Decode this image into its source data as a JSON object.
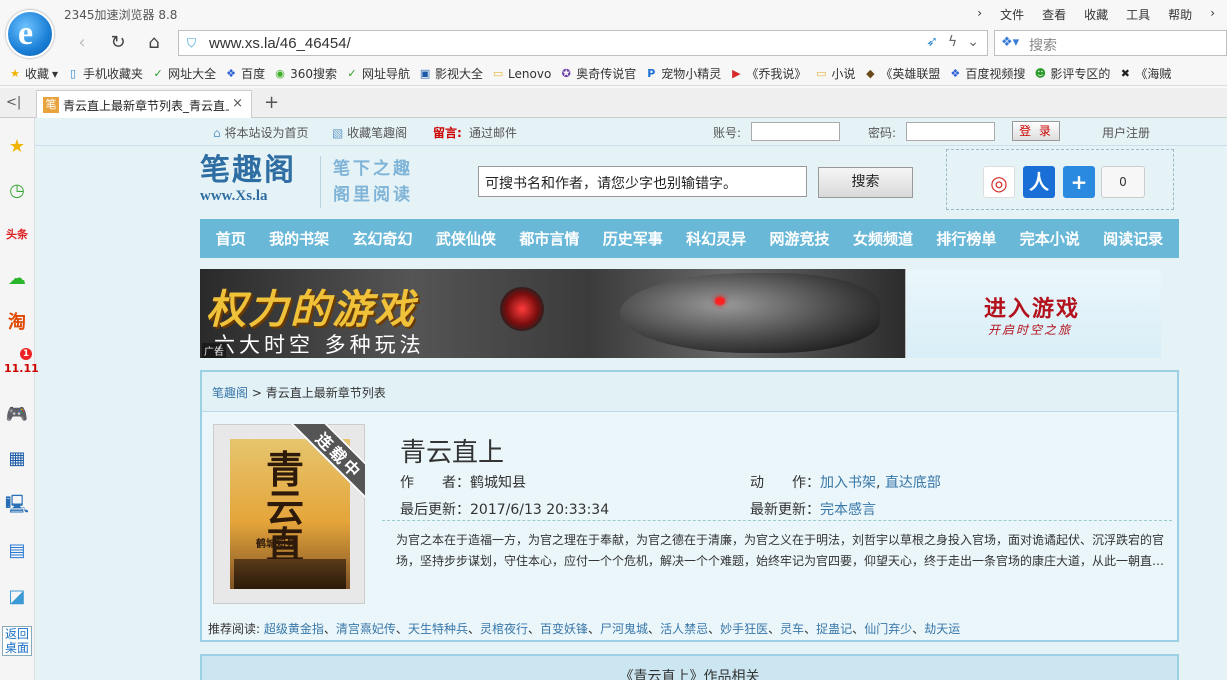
{
  "browser": {
    "app_title": "2345加速浏览器 8.8",
    "logo_letter": "e",
    "menu": [
      "文件",
      "查看",
      "收藏",
      "工具",
      "帮助"
    ],
    "url": "www.xs.la/46_46454/",
    "search_placeholder": "搜索",
    "bookmarks": [
      {
        "label": "收藏",
        "icon": "star-icon"
      },
      {
        "label": "手机收藏夹",
        "icon": "phone-icon"
      },
      {
        "label": "网址大全",
        "icon": "hao-icon"
      },
      {
        "label": "百度",
        "icon": "baidu-paw-icon"
      },
      {
        "label": "360搜索",
        "icon": "360-icon"
      },
      {
        "label": "网址导航",
        "icon": "hao-icon"
      },
      {
        "label": "影视大全",
        "icon": "video-icon"
      },
      {
        "label": "Lenovo",
        "icon": "folder-icon"
      },
      {
        "label": "奥奇传说官",
        "icon": "game-icon"
      },
      {
        "label": "宠物小精灵",
        "icon": "p-icon"
      },
      {
        "label": "《乔我说》",
        "icon": "play-icon"
      },
      {
        "label": "小说",
        "icon": "folder-icon"
      },
      {
        "label": "《英雄联盟",
        "icon": "lol-icon"
      },
      {
        "label": "百度视频搜",
        "icon": "baidu-paw-icon"
      },
      {
        "label": "影评专区的",
        "icon": "panda-icon"
      },
      {
        "label": "《海贼",
        "icon": "pirate-icon"
      }
    ],
    "tab": {
      "favicon": "笔",
      "title": "青云直上最新章节列表_青云直上",
      "close": "×"
    },
    "new_tab": "+",
    "sidebar_back": "返回桌面",
    "sidebar_badge": "1"
  },
  "site": {
    "topbar": {
      "set_home": "将本站设为首页",
      "bookmark": "收藏笔趣阁",
      "message_label": "留言:",
      "message_link": "通过邮件",
      "account_label": "账号:",
      "password_label": "密码:",
      "login": "登 录",
      "register": "用户注册"
    },
    "logo_cn": "笔趣阁",
    "logo_en": "www.Xs.la",
    "slogan_1": "笔下之趣",
    "slogan_2": "阁里阅读",
    "search_text": "可搜书名和作者，请您少字也别输错字。",
    "search_button": "搜索",
    "share_count": "0",
    "nav": [
      "首页",
      "我的书架",
      "玄幻奇幻",
      "武侠仙侠",
      "都市言情",
      "历史军事",
      "科幻灵异",
      "网游竞技",
      "女频频道",
      "排行榜单",
      "完本小说",
      "阅读记录"
    ],
    "banner": {
      "title": "权力的游戏",
      "subtitle": "六大时空 多种玩法",
      "ad": "广告",
      "cta": "进入游戏",
      "cta_sub": "开启时空之旅"
    },
    "breadcrumb": {
      "home": "笔趣阁",
      "sep": ">",
      "current": "青云直上最新章节列表"
    },
    "book": {
      "title": "青云直上",
      "cover_title": "青云直上",
      "cover_author": "鹤城知县",
      "ribbon": "连载中",
      "author_label": "作　　者：",
      "author": "鹤城知县",
      "action_label": "动　　作：",
      "action_add": "加入书架",
      "action_bottom": "直达底部",
      "updated_label": "最后更新：",
      "updated": "2017/6/13 20:33:34",
      "latest_label": "最新更新：",
      "latest": "完本感言",
      "intro": "为官之本在于造福一方，为官之理在于奉献，为官之德在于清廉，为官之义在于明法，刘哲宇以草根之身投入官场，面对诡谲起伏、沉浮跌宕的官场，坚持步步谋划，守住本心，应付一个个危机，解决一个个难题，始终牢记为官四要，仰望天心，终于走出一条官场的康庄大道，从此一朝直…"
    },
    "recommend_label": "推荐阅读:",
    "recommend": [
      "超级黄金指",
      "清宫熹妃传",
      "天生特种兵",
      "灵棺夜行",
      "百变妖锋",
      "尸河鬼城",
      "活人禁忌",
      "妙手狂医",
      "灵车",
      "捉蛊记",
      "仙门弃少",
      "劫天运"
    ],
    "related_title": "《青云直上》作品相关"
  },
  "colors": {
    "nav": "#6ab8d8",
    "link": "#3977a8",
    "accent_red": "#b3111b"
  }
}
